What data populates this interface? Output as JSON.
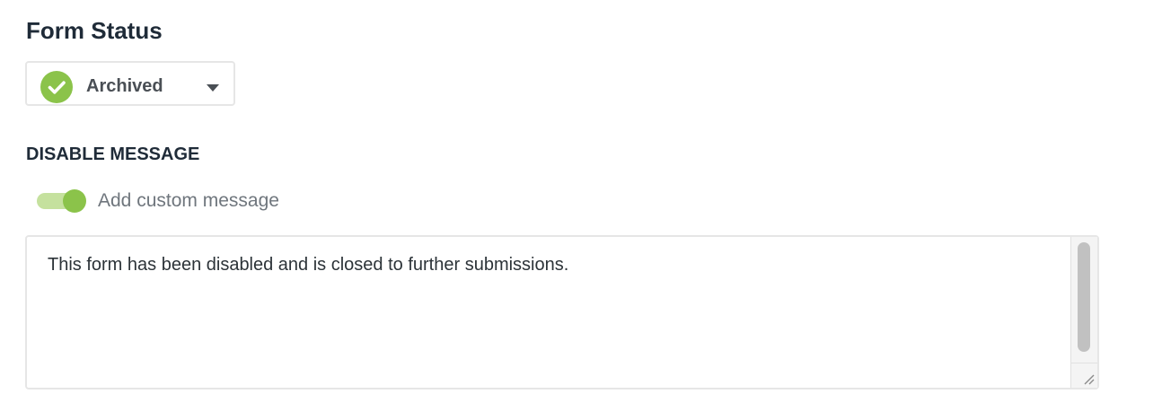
{
  "form_status": {
    "title": "Form Status",
    "selected_status": "Archived",
    "status_icon": "check-circle-icon",
    "status_color": "#8bc34a"
  },
  "disable_message": {
    "title": "DISABLE MESSAGE",
    "toggle": {
      "label": "Add custom message",
      "enabled": true,
      "on_color": "#8bc34a"
    },
    "message": "This form has been disabled and is closed to further submissions."
  }
}
